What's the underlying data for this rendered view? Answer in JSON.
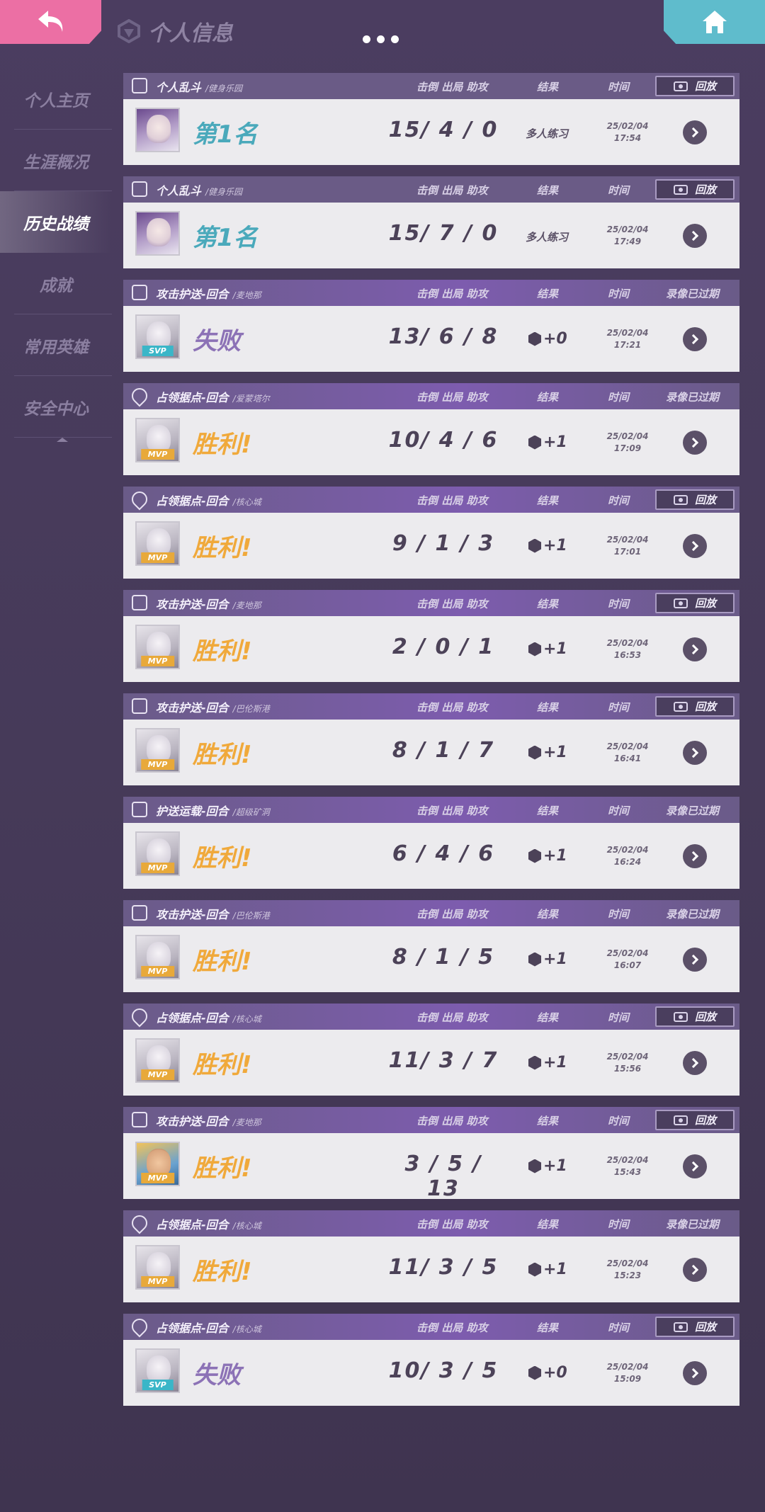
{
  "header": {
    "title": "个人信息",
    "back_icon": "back-arrow-icon",
    "home_icon": "home-icon"
  },
  "sidebar": {
    "items": [
      {
        "label": "个人主页",
        "active": false
      },
      {
        "label": "生涯概况",
        "active": false
      },
      {
        "label": "历史战绩",
        "active": true
      },
      {
        "label": "成就",
        "active": false
      },
      {
        "label": "常用英雄",
        "active": false
      },
      {
        "label": "安全中心",
        "active": false
      }
    ]
  },
  "columns": {
    "stats": "击倒 出局 助攻",
    "result": "结果",
    "time": "时间",
    "replay": "回放",
    "expired": "录像已过期"
  },
  "matches": [
    {
      "mode": "个人乱斗",
      "map": "/健身乐园",
      "result": "第1名",
      "result_type": "rank",
      "kda": "15/ 4 / 0",
      "score": "多人练习",
      "score_type": "text",
      "date": "25/02/04",
      "clock": "17:54",
      "replay": true,
      "avatar": "girl",
      "badge": ""
    },
    {
      "mode": "个人乱斗",
      "map": "/健身乐园",
      "result": "第1名",
      "result_type": "rank",
      "kda": "15/ 7 / 0",
      "score": "多人练习",
      "score_type": "text",
      "date": "25/02/04",
      "clock": "17:49",
      "replay": true,
      "avatar": "girl",
      "badge": ""
    },
    {
      "mode": "攻击护送-回合",
      "map": "/麦地那",
      "result": "失败",
      "result_type": "lose",
      "kda": "13/ 6 / 8",
      "score": "+0",
      "score_type": "hex",
      "date": "25/02/04",
      "clock": "17:21",
      "replay": false,
      "avatar": "beast",
      "badge": "SVP"
    },
    {
      "mode": "占领据点-回合",
      "map": "/爱蒙塔尔",
      "result": "胜利!",
      "result_type": "win",
      "kda": "10/ 4 / 6",
      "score": "+1",
      "score_type": "hex",
      "date": "25/02/04",
      "clock": "17:09",
      "replay": false,
      "avatar": "beast",
      "badge": "MVP"
    },
    {
      "mode": "占领据点-回合",
      "map": "/核心城",
      "result": "胜利!",
      "result_type": "win",
      "kda": "9 / 1 / 3",
      "score": "+1",
      "score_type": "hex",
      "date": "25/02/04",
      "clock": "17:01",
      "replay": true,
      "avatar": "beast",
      "badge": "MVP"
    },
    {
      "mode": "攻击护送-回合",
      "map": "/麦地那",
      "result": "胜利!",
      "result_type": "win",
      "kda": "2 / 0 / 1",
      "score": "+1",
      "score_type": "hex",
      "date": "25/02/04",
      "clock": "16:53",
      "replay": true,
      "avatar": "beast",
      "badge": "MVP"
    },
    {
      "mode": "攻击护送-回合",
      "map": "/巴伦斯港",
      "result": "胜利!",
      "result_type": "win",
      "kda": "8 / 1 / 7",
      "score": "+1",
      "score_type": "hex",
      "date": "25/02/04",
      "clock": "16:41",
      "replay": true,
      "avatar": "beast",
      "badge": "MVP"
    },
    {
      "mode": "护送运载-回合",
      "map": "/超级矿洞",
      "result": "胜利!",
      "result_type": "win",
      "kda": "6 / 4 / 6",
      "score": "+1",
      "score_type": "hex",
      "date": "25/02/04",
      "clock": "16:24",
      "replay": false,
      "avatar": "beast",
      "badge": "MVP"
    },
    {
      "mode": "攻击护送-回合",
      "map": "/巴伦斯港",
      "result": "胜利!",
      "result_type": "win",
      "kda": "8 / 1 / 5",
      "score": "+1",
      "score_type": "hex",
      "date": "25/02/04",
      "clock": "16:07",
      "replay": false,
      "avatar": "beast",
      "badge": "MVP"
    },
    {
      "mode": "占领据点-回合",
      "map": "/核心城",
      "result": "胜利!",
      "result_type": "win",
      "kda": "11/ 3 / 7",
      "score": "+1",
      "score_type": "hex",
      "date": "25/02/04",
      "clock": "15:56",
      "replay": true,
      "avatar": "beast",
      "badge": "MVP"
    },
    {
      "mode": "攻击护送-回合",
      "map": "/麦地那",
      "result": "胜利!",
      "result_type": "win",
      "kda": "3 / 5 / 13",
      "score": "+1",
      "score_type": "hex",
      "date": "25/02/04",
      "clock": "15:43",
      "replay": true,
      "avatar": "boy",
      "badge": "MVP"
    },
    {
      "mode": "占领据点-回合",
      "map": "/核心城",
      "result": "胜利!",
      "result_type": "win",
      "kda": "11/ 3 / 5",
      "score": "+1",
      "score_type": "hex",
      "date": "25/02/04",
      "clock": "15:23",
      "replay": false,
      "avatar": "beast",
      "badge": "MVP"
    },
    {
      "mode": "占领据点-回合",
      "map": "/核心城",
      "result": "失败",
      "result_type": "lose",
      "kda": "10/ 3 / 5",
      "score": "+0",
      "score_type": "hex",
      "date": "25/02/04",
      "clock": "15:09",
      "replay": true,
      "avatar": "beast",
      "badge": "SVP"
    }
  ],
  "colors": {
    "win": "#f0a93b",
    "lose": "#8c72b6",
    "rank": "#4aa9bb",
    "back_button": "#ec6fa4",
    "home_button": "#5fbccc"
  }
}
